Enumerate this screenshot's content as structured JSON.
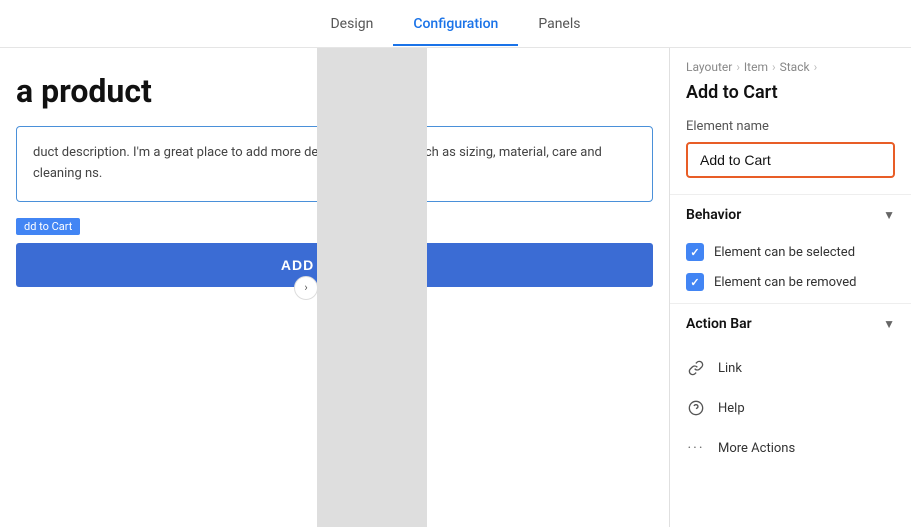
{
  "topNav": {
    "tabs": [
      {
        "id": "design",
        "label": "Design",
        "active": false
      },
      {
        "id": "configuration",
        "label": "Configuration",
        "active": true
      },
      {
        "id": "panels",
        "label": "Panels",
        "active": false
      }
    ]
  },
  "canvas": {
    "productTitle": "a product",
    "productDesc": "duct description. I'm a great place to add more details ur product, such as sizing, material, care and cleaning ns.",
    "addToCartLabel": "dd to Cart",
    "addToCartButton": "ADD TO CART"
  },
  "rightPanel": {
    "breadcrumb": {
      "items": [
        "Layouter",
        "Item",
        "Stack"
      ]
    },
    "title": "Add to Cart",
    "elementNameSection": {
      "label": "Element name",
      "value": "Add to Cart",
      "placeholder": "Add to Cart"
    },
    "behaviorSection": {
      "title": "Behavior",
      "items": [
        {
          "id": "can-be-selected",
          "label": "Element can be selected",
          "checked": true
        },
        {
          "id": "can-be-removed",
          "label": "Element can be removed",
          "checked": true
        }
      ]
    },
    "actionBarSection": {
      "title": "Action Bar",
      "items": [
        {
          "id": "link",
          "icon": "🔗",
          "label": "Link"
        },
        {
          "id": "help",
          "icon": "?",
          "label": "Help"
        },
        {
          "id": "more-actions",
          "icon": "•••",
          "label": "More Actions"
        }
      ]
    }
  }
}
